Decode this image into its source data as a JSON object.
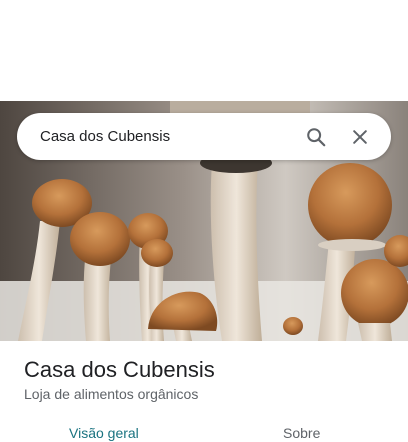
{
  "search": {
    "query": "Casa dos Cubensis",
    "search_icon": "search-icon",
    "close_icon": "close-icon"
  },
  "hero": {
    "image": "mushrooms-photo"
  },
  "place": {
    "name": "Casa dos Cubensis",
    "category": "Loja de alimentos orgânicos"
  },
  "tabs": [
    {
      "label": "Visão geral",
      "active": true
    },
    {
      "label": "Sobre",
      "active": false
    }
  ],
  "colors": {
    "accent": "#1a7380",
    "text_primary": "#202124",
    "text_secondary": "#5f6368"
  }
}
